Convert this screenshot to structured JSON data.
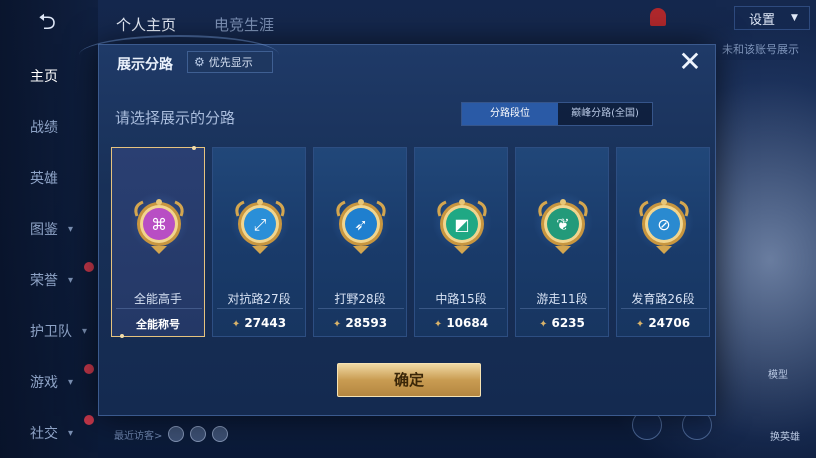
{
  "nav": {
    "back_icon": "back-arrow-icon",
    "top_tabs": [
      "个人主页",
      "电竞生涯"
    ],
    "settings_label": "设置",
    "right_tag": "未和该账号展示"
  },
  "sidebar": {
    "items": [
      {
        "label": "主页",
        "active": true,
        "chevron": false,
        "new": false
      },
      {
        "label": "战绩",
        "active": false,
        "chevron": false,
        "new": false
      },
      {
        "label": "英雄",
        "active": false,
        "chevron": false,
        "new": false
      },
      {
        "label": "图鉴",
        "active": false,
        "chevron": true,
        "new": false
      },
      {
        "label": "荣誉",
        "active": false,
        "chevron": true,
        "new": true
      },
      {
        "label": "护卫队",
        "active": false,
        "chevron": true,
        "new": false
      },
      {
        "label": "游戏",
        "active": false,
        "chevron": true,
        "new": true
      },
      {
        "label": "社交",
        "active": false,
        "chevron": true,
        "new": true
      }
    ]
  },
  "footer": {
    "recent_visitors_label": "最近访客>",
    "model_label": "模型",
    "change_hero_label": "换英雄"
  },
  "modal": {
    "title": "展示分路",
    "priority_label": "优先显示",
    "subtitle": "请选择展示的分路",
    "segments": [
      "分路段位",
      "巅峰分路(全国)"
    ],
    "confirm_label": "确定",
    "cards": [
      {
        "lane": "全能高手",
        "value": "全能称号",
        "selected": true,
        "icon": "all-round-emblem-icon",
        "color": "#b84ec4"
      },
      {
        "lane": "对抗路27段",
        "value": "27443",
        "selected": false,
        "icon": "clash-lane-emblem-icon",
        "color": "#2a8fd8"
      },
      {
        "lane": "打野28段",
        "value": "28593",
        "selected": false,
        "icon": "jungle-emblem-icon",
        "color": "#1f7fcf"
      },
      {
        "lane": "中路15段",
        "value": "10684",
        "selected": false,
        "icon": "mid-lane-emblem-icon",
        "color": "#1fa884"
      },
      {
        "lane": "游走11段",
        "value": "6235",
        "selected": false,
        "icon": "roam-emblem-icon",
        "color": "#239a7a"
      },
      {
        "lane": "发育路26段",
        "value": "24706",
        "selected": false,
        "icon": "farm-lane-emblem-icon",
        "color": "#2a8ad0"
      }
    ]
  }
}
